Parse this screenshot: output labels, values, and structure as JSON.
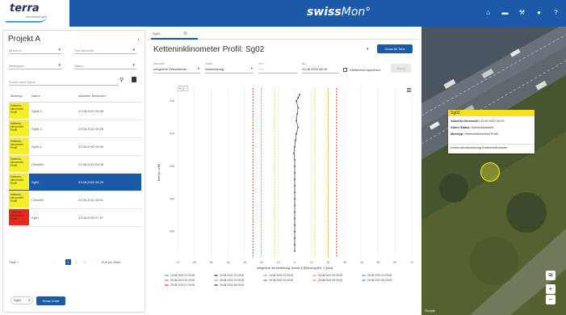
{
  "header": {
    "logo_text": "terra",
    "logo_sub": "vermessungen",
    "app_title_main": "swiss",
    "app_title_tail": "Mon°",
    "nav_icons": [
      "home-icon",
      "folder-icon",
      "wrench-icon",
      "user-icon",
      "help-icon"
    ]
  },
  "left": {
    "project_title": "Projekt A",
    "filters": [
      {
        "label": "Bereiche"
      },
      {
        "label": "Sub Bereiche"
      },
      {
        "label": "Messtypen"
      },
      {
        "label": "Status"
      }
    ],
    "search_placeholder": "Suche nach Name",
    "table": {
      "headers": [
        "Messtyp",
        "Name",
        "Aktueller Messwert"
      ],
      "rows": [
        {
          "type": "Kettenin-klinometer Profil",
          "name": "Sg06-2",
          "date": "23.08.2022 08:28",
          "color": "#f6ee28",
          "selected": false
        },
        {
          "type": "Kettenin-klinometer Profil",
          "name": "Sg06-3",
          "date": "23.08.2022 08:28",
          "color": "#f6ee28",
          "selected": false
        },
        {
          "type": "Kettenin-klinometer Profil",
          "name": "Sg06-1",
          "date": "23.08.2022 08:29",
          "color": "#f6ee28",
          "selected": false
        },
        {
          "type": "Kettenin-klinometer Profil",
          "name": "Christ50",
          "date": "23.08.2022 08:28",
          "color": "#f6ee28",
          "selected": false
        },
        {
          "type": "Kettenin-klinometer Profil",
          "name": "Sg02",
          "date": "23.08.2022 08:29",
          "color": "#f6ee28",
          "selected": true
        },
        {
          "type": "Kettenin-klinometer Profil",
          "name": "Christ50",
          "date": "23.08.2022 08:01",
          "color": "#f6ee28",
          "selected": false
        },
        {
          "type": "Kettenin-klinometer Profil",
          "name": "Sg01",
          "date": "23.08.2022 07:57",
          "color": "#e8281e",
          "selected": false
        }
      ]
    },
    "pager": {
      "total": "Total: 7",
      "pages": [
        "1",
        "2",
        "3"
      ],
      "current": "1",
      "per_page": "10",
      "per_page_label": "pro Seite"
    },
    "chip": "Sg02",
    "show_chart": "Show Chart"
  },
  "chart_panel": {
    "tab": "Sg02",
    "title": "Ketteninklinometer Profil: Sg02",
    "close_all": "Close All Tabs",
    "fields": [
      {
        "label": "Messwert",
        "value": "Integrierte Verschiebun..."
      },
      {
        "label": "Status",
        "value": "Nullmessung"
      },
      {
        "label": "Von",
        "value": "Von"
      },
      {
        "label": "Bis",
        "value": "23.08.2022 08:29"
      }
    ],
    "save_range": "Zeitbereich speichern",
    "apply": "Apply",
    "zoom_in": "+",
    "zoom_out": "-"
  },
  "chart_data": {
    "type": "line",
    "xlabel": "Integrierte Verschiebung, Achse A (Richtung BH +) [mm]",
    "ylabel": "Tiefe [m ü.M]",
    "xlim": [
      -70,
      70
    ],
    "ylim": [
      391,
      417
    ],
    "x_ticks": [
      -70,
      -60,
      -50,
      -40,
      -30,
      -20,
      -10,
      0,
      10,
      20,
      30,
      40,
      50,
      60,
      70
    ],
    "y_ticks": [
      395,
      400,
      405,
      410,
      415
    ],
    "series": {
      "values": [
        [
          3,
          416
        ],
        [
          2,
          415.5
        ],
        [
          1,
          415
        ],
        [
          2,
          414
        ],
        [
          1.5,
          413
        ],
        [
          1,
          412
        ],
        [
          2,
          411
        ],
        [
          1,
          410
        ],
        [
          0.5,
          409
        ],
        [
          0,
          408
        ],
        [
          -0.5,
          407
        ],
        [
          0,
          406
        ],
        [
          0,
          405
        ],
        [
          0,
          404
        ],
        [
          0,
          403
        ],
        [
          0,
          402
        ],
        [
          0,
          401
        ],
        [
          0,
          400
        ],
        [
          0,
          399
        ],
        [
          0,
          398
        ],
        [
          0,
          397
        ],
        [
          0,
          396
        ],
        [
          0,
          395
        ],
        [
          0,
          394
        ],
        [
          0,
          393
        ],
        [
          0,
          392
        ]
      ],
      "color": "#555555"
    },
    "threshold_lines": [
      {
        "x": -25,
        "color": "#e8281e"
      },
      {
        "x": -20,
        "color": "#f39c1e"
      },
      {
        "x": -12,
        "color": "#f6d22a"
      },
      {
        "x": 12,
        "color": "#f6d22a"
      },
      {
        "x": 20,
        "color": "#f39c1e"
      },
      {
        "x": 25,
        "color": "#e8281e"
      }
    ],
    "legend": [
      {
        "label": "24.08.2022 21:29:00",
        "color": "#5b8fd6"
      },
      {
        "label": "24.08.2022 22:29:00",
        "color": "#333333"
      },
      {
        "label": "24.08.2022 23:29:00",
        "color": "#7dc46a"
      },
      {
        "label": "25.08.2022 00:29:00",
        "color": "#f0a030"
      },
      {
        "label": "25.08.2022 01:29:00",
        "color": "#5b8fd6"
      },
      {
        "label": "25.08.2022 02:29:00",
        "color": "#e85a7a"
      },
      {
        "label": "25.08.2022 03:29:00",
        "color": "#5ab4c8"
      },
      {
        "label": "25.08.2022 04:29:00",
        "color": "#8a5ac8"
      },
      {
        "label": "25.08.2022 05:29:00",
        "color": "#c8a05a"
      },
      {
        "label": "25.08.2022 06:29:00",
        "color": "#5b8fd6"
      },
      {
        "label": "25.08.2022 07:29:00",
        "color": "#e8281e"
      },
      {
        "label": "25.08.2022 08:29:00",
        "color": "#333333"
      }
    ],
    "grid": true
  },
  "map": {
    "popup": {
      "title": "Sg02",
      "current_label": "Aktueller Messwert:",
      "current_value": "23.08.2022 08:29",
      "alarm_label": "Alarm Status:",
      "alarm_value": "Aufmerksamkeit",
      "type_label": "Messtyp:",
      "type_value": "Ketteninklinometer Profil",
      "desc": "Deformationsmessung Ketteninklinometer"
    },
    "layers_icon": "layers-icon",
    "zoom_in": "+",
    "zoom_out": "−",
    "attribution": "Google"
  },
  "colors": {
    "brand": "#1a5aa8",
    "yellow": "#f6ee28",
    "red": "#e8281e"
  }
}
